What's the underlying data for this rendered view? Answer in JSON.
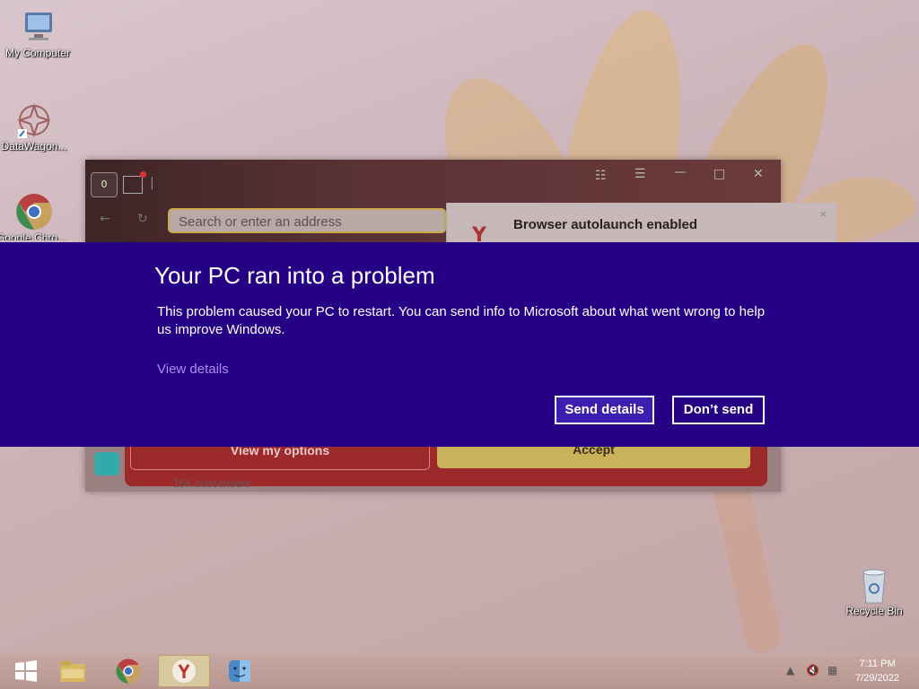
{
  "desktop": {
    "icons": [
      {
        "label": "My Computer",
        "icon": "computer-icon"
      },
      {
        "label": "DataWagon...",
        "icon": "datawagon-icon"
      },
      {
        "label": "Google Chrome",
        "icon": "chrome-icon"
      },
      {
        "label": "Recycle Bin",
        "icon": "recycle-bin-icon"
      }
    ]
  },
  "browser": {
    "home_tab_badge": "0",
    "address_placeholder": "Search or enter an address",
    "notification": {
      "title": "Browser autolaunch enabled",
      "close": "×"
    },
    "buttons": {
      "options": "View my options",
      "accept": "Accept"
    },
    "subscribers": "15K subscribers",
    "window_controls": [
      "bookmarks",
      "menu",
      "minimize",
      "maximize",
      "close"
    ]
  },
  "error_banner": {
    "title": "Your PC ran into a problem",
    "message": "This problem caused your PC to restart. You can send info to Microsoft about what went wrong to help us improve Windows.",
    "view_details": "View details",
    "send_button": "Send details",
    "dont_send_button": "Don’t send",
    "background": "#250084"
  },
  "taskbar": {
    "apps": [
      "start",
      "file-explorer",
      "chrome",
      "yandex",
      "finder"
    ],
    "active_app": "yandex",
    "time": "7:11 PM",
    "date": "7/29/2022"
  }
}
